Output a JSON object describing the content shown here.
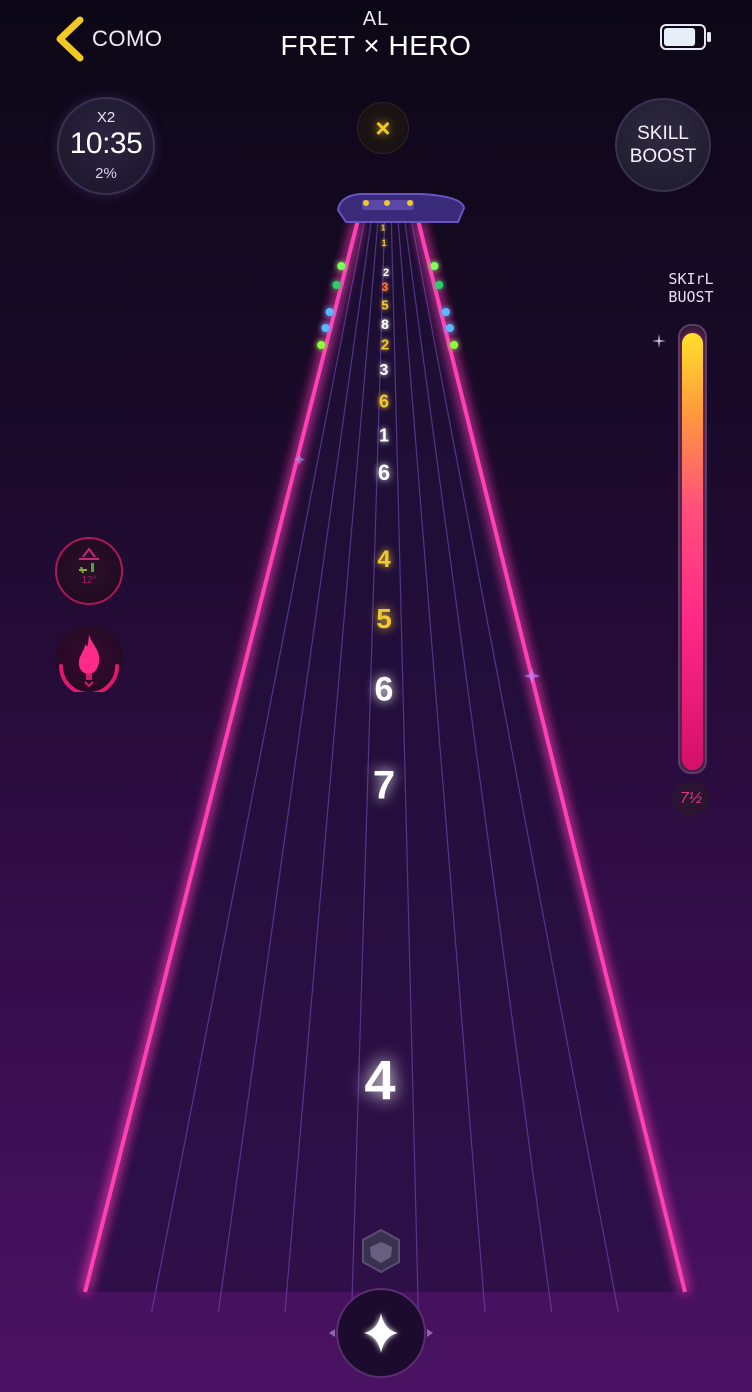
{
  "header": {
    "back_label": "COMO",
    "title_top": "AL",
    "title_main": "FRET × HERO",
    "battery_level": 0.85
  },
  "timer": {
    "multiplier": "X2",
    "time": "10:35",
    "percent": "2%"
  },
  "center_button": {
    "symbol": "×"
  },
  "skill_button": {
    "line1": "SKILL",
    "line2": "BOOST"
  },
  "skill_meter": {
    "label_line1": "SKIrL",
    "label_line2": "BUOST",
    "level": 0.98,
    "value": "7½"
  },
  "side_buttons": {
    "icon1_caption": "12°"
  },
  "fretboard": {
    "fret_numbers": [
      {
        "text": "1",
        "color": "#f0c930"
      },
      {
        "text": "1",
        "color": "#f0c930"
      },
      {
        "text": "2",
        "color": "#ffffff"
      },
      {
        "text": "3",
        "color": "#ff7a3a"
      },
      {
        "text": "5",
        "color": "#f0c930"
      },
      {
        "text": "8",
        "color": "#ffffff"
      },
      {
        "text": "2",
        "color": "#f0c930"
      },
      {
        "text": "3",
        "color": "#ffffff"
      },
      {
        "text": "6",
        "color": "#f0c930"
      },
      {
        "text": "1",
        "color": "#ffffff"
      },
      {
        "text": "6",
        "color": "#ffffff"
      },
      {
        "text": "4",
        "color": "#f0c930"
      },
      {
        "text": "5",
        "color": "#f0c930"
      },
      {
        "text": "6",
        "color": "#ffffff"
      },
      {
        "text": "7",
        "color": "#ffffff"
      },
      {
        "text": "4",
        "color": "#ffffff"
      }
    ],
    "colors": {
      "rail": "#ff3fb4",
      "fret": "#b98cff",
      "highlight": "#ffd0c0",
      "grid": "#7a55c8"
    }
  }
}
